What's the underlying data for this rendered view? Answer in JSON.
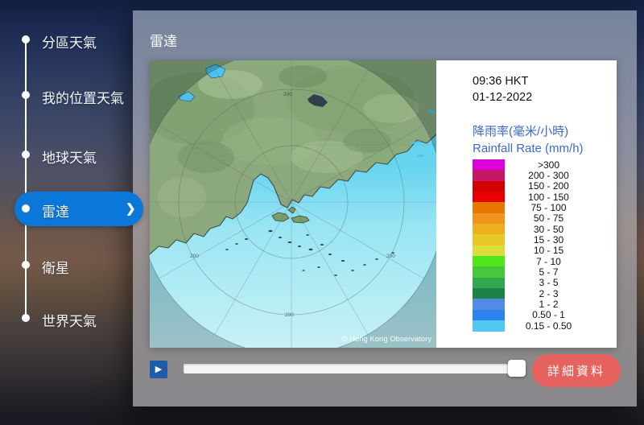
{
  "sidebar": {
    "chevron": "❯",
    "items": [
      {
        "label": "分區天氣",
        "selected": false
      },
      {
        "label": "我的位置天氣",
        "selected": false
      },
      {
        "label": "地球天氣",
        "selected": false
      },
      {
        "label": "雷達",
        "selected": true
      },
      {
        "label": "衛星",
        "selected": false
      },
      {
        "label": "世界天氣",
        "selected": false
      }
    ]
  },
  "panel": {
    "title": "雷達",
    "play_icon": "▶",
    "details_button": "詳細資料"
  },
  "radar": {
    "timestamp_time": "09:36 HKT",
    "timestamp_date": "01-12-2022",
    "heading_zh": "降雨率(毫米/小時)",
    "heading_en": "Rainfall Rate (mm/h)",
    "range_label": "200",
    "copyright": "© Hong Kong Observatory",
    "legend": [
      {
        "label": ">300",
        "color": "#DC00DC"
      },
      {
        "label": "200 - 300",
        "color": "#C81666"
      },
      {
        "label": "150 - 200",
        "color": "#D00000"
      },
      {
        "label": "100 - 150",
        "color": "#E80000"
      },
      {
        "label": "75 - 100",
        "color": "#E87800"
      },
      {
        "label": "50 - 75",
        "color": "#F0941E"
      },
      {
        "label": "30 - 50",
        "color": "#ECB01E"
      },
      {
        "label": "15 - 30",
        "color": "#E8C828"
      },
      {
        "label": "10 - 15",
        "color": "#DCDC3C"
      },
      {
        "label": "7 - 10",
        "color": "#50E61E"
      },
      {
        "label": "5 - 7",
        "color": "#46C83C"
      },
      {
        "label": "3 - 5",
        "color": "#32A850"
      },
      {
        "label": "2 - 3",
        "color": "#1E8246"
      },
      {
        "label": "1 - 2",
        "color": "#508CE6"
      },
      {
        "label": "0.50 - 1",
        "color": "#2E82F0"
      },
      {
        "label": "0.15 - 0.50",
        "color": "#50C8F0"
      }
    ]
  },
  "colors": {
    "accent_blue": "#0B77D8",
    "button_red": "#E5625F",
    "legend_heading_blue": "#3A6BC8"
  }
}
